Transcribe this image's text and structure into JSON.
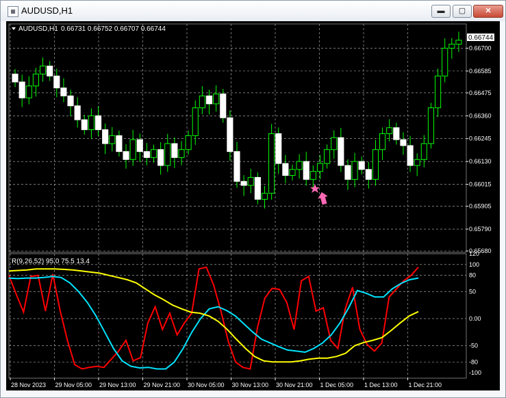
{
  "window": {
    "title": "AUDUSD,H1",
    "minimize_glyph": "▬",
    "maximize_glyph": "▢",
    "close_glyph": "✕"
  },
  "chart_info": {
    "symbol_label": "AUDUSD,H1",
    "ohlc": "0.66731 0.66752 0.66707 0.66744",
    "current_price": "0.66744"
  },
  "indicator_info": {
    "label": "R(9,26,52) 95.0 75.5 13.4"
  },
  "price_axis": [
    "0.66700",
    "0.66585",
    "0.66475",
    "0.66360",
    "0.66245",
    "0.66130",
    "0.66015",
    "0.65905",
    "0.65790",
    "0.65680"
  ],
  "indicator_axis": [
    "120",
    "100",
    "80",
    "50",
    "0.00",
    "-50",
    "-80",
    "-100"
  ],
  "time_axis": [
    "28 Nov 2023",
    "29 Nov 05:00",
    "29 Nov 13:00",
    "29 Nov 21:00",
    "30 Nov 05:00",
    "30 Nov 13:00",
    "30 Nov 21:00",
    "1 Dec 05:00",
    "1 Dec 13:00",
    "1 Dec 21:00"
  ],
  "colors": {
    "background": "#000000",
    "grid": "#c0c0c0",
    "candle_up": "#00ff00",
    "candle_down": "#ffffff",
    "fast_line": "#ff0000",
    "mid_line": "#00e5ff",
    "slow_line": "#ffff00",
    "signal_arrow": "#ff69b4"
  },
  "chart_data": {
    "type": "line",
    "title": "AUDUSD,H1",
    "price_ylim": [
      0.6568,
      0.6676
    ],
    "indicator_ylim": [
      -110,
      120
    ],
    "candles_close": [
      0.6653,
      0.6645,
      0.6651,
      0.6657,
      0.6661,
      0.6656,
      0.665,
      0.6646,
      0.6641,
      0.6634,
      0.6629,
      0.6636,
      0.6629,
      0.6622,
      0.6626,
      0.6618,
      0.6614,
      0.6624,
      0.6618,
      0.6615,
      0.6619,
      0.6611,
      0.6622,
      0.6615,
      0.6619,
      0.6626,
      0.664,
      0.6646,
      0.6642,
      0.6647,
      0.6635,
      0.6618,
      0.6603,
      0.6601,
      0.6605,
      0.6594,
      0.6597,
      0.6627,
      0.6612,
      0.6606,
      0.6609,
      0.6613,
      0.6604,
      0.6608,
      0.6612,
      0.6619,
      0.6625,
      0.6611,
      0.6604,
      0.6613,
      0.6609,
      0.6604,
      0.6619,
      0.6627,
      0.663,
      0.6624,
      0.6621,
      0.6611,
      0.6614,
      0.6622,
      0.664,
      0.6656,
      0.667,
      0.6672,
      0.6674
    ],
    "series": [
      {
        "name": "R(9,26,52) 9",
        "values": [
          80,
          45,
          12,
          78,
          80,
          14,
          82,
          15,
          -40,
          -85,
          -93,
          -90,
          -88,
          -90,
          -75,
          -60,
          -40,
          -78,
          -72,
          -8,
          22,
          -20,
          10,
          -30,
          -8,
          10,
          92,
          95,
          62,
          14,
          -42,
          -80,
          -90,
          -93,
          -16,
          38,
          56,
          54,
          30,
          -20,
          70,
          78,
          14,
          20,
          -40,
          -55,
          18,
          58,
          -20,
          -48,
          -60,
          -45,
          40,
          55,
          70,
          80,
          95
        ]
      },
      {
        "name": "R(9,26,52) 26",
        "values": [
          75,
          74,
          75,
          75,
          76,
          78,
          76,
          66,
          50,
          30,
          5,
          -25,
          -55,
          -78,
          -88,
          -91,
          -90,
          -93,
          -93,
          -80,
          -55,
          -25,
          0,
          18,
          22,
          15,
          5,
          -10,
          -25,
          -38,
          -45,
          -52,
          -58,
          -60,
          -62,
          -55,
          -45,
          -30,
          -8,
          20,
          52,
          47,
          40,
          40,
          55,
          65,
          72,
          75
        ]
      },
      {
        "name": "R(9,26,52) 52",
        "values": [
          88,
          89,
          90,
          92,
          92,
          92,
          91,
          90,
          88,
          86,
          84,
          80,
          76,
          72,
          66,
          55,
          44,
          35,
          25,
          18,
          12,
          10,
          5,
          -5,
          -20,
          -38,
          -55,
          -70,
          -78,
          -80,
          -80,
          -80,
          -78,
          -75,
          -73,
          -73,
          -70,
          -64,
          -50,
          -44,
          -40,
          -35,
          -22,
          -8,
          5,
          13
        ]
      }
    ]
  }
}
